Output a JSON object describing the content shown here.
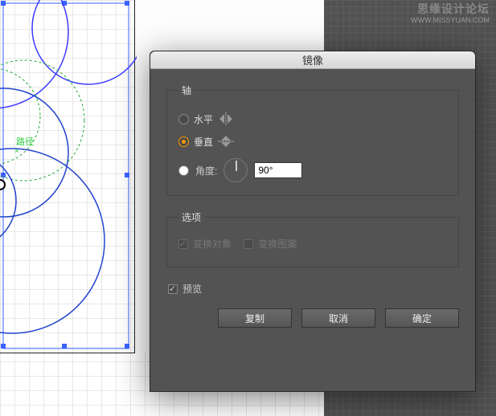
{
  "watermark": {
    "title": "思缘设计论坛",
    "url": "WWW.MISSYUAN.COM"
  },
  "artwork": {
    "label": "路径"
  },
  "dialog": {
    "title": "镜像",
    "axis": {
      "legend": "轴",
      "horizontal": "水平",
      "vertical": "垂直",
      "angle_label": "角度:",
      "angle_value": "90°"
    },
    "options": {
      "legend": "选项",
      "transform_objects": "变换对象",
      "transform_patterns": "变换图案"
    },
    "preview": "预览",
    "buttons": {
      "copy": "复制",
      "cancel": "取消",
      "ok": "确定"
    }
  }
}
